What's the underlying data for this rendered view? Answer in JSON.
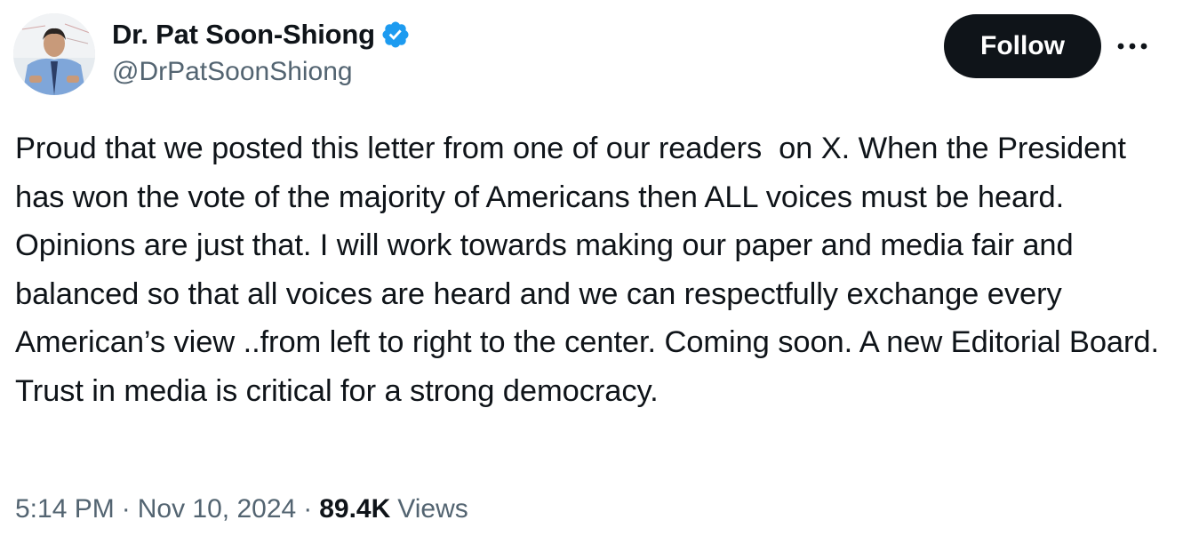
{
  "tweet": {
    "author": {
      "display_name": "Dr. Pat Soon-Shiong",
      "handle": "@DrPatSoonShiong",
      "verified": true,
      "avatar_icon": "profile-photo"
    },
    "follow_label": "Follow",
    "more_icon": "more-horizontal-icon",
    "text": "Proud that we posted this letter from one of our readers  on X. When the President has won the vote of the majority of Americans then ALL voices must be heard. Opinions are just that. I will work towards making our paper and media fair and balanced so that all voices are heard and we can respectfully exchange every American’s view ..from left to right to the center. Coming soon. A new Editorial Board. Trust in media is critical for a strong democracy.",
    "meta": {
      "time": "5:14 PM",
      "separator": "·",
      "date": "Nov 10, 2024",
      "views_count": "89.4K",
      "views_label": "Views"
    }
  },
  "colors": {
    "text_primary": "#0f1419",
    "text_secondary": "#536471",
    "verified_blue": "#1d9bf0",
    "follow_bg": "#0f1419",
    "follow_text": "#ffffff"
  }
}
